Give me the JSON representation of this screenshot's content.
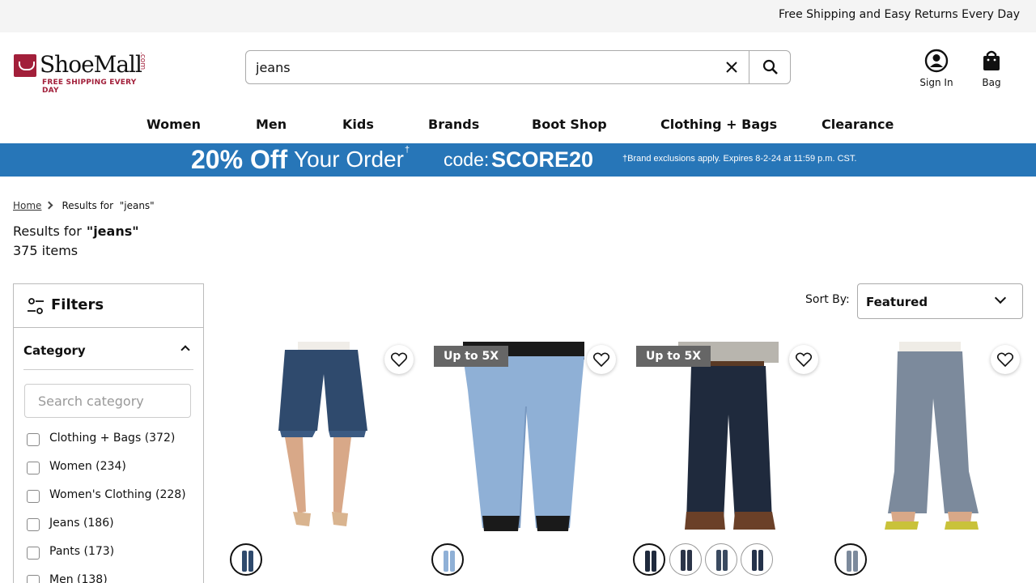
{
  "topbar": {
    "promo": "Free Shipping and Easy Returns Every Day"
  },
  "logo": {
    "name": "ShoeMall",
    "suffix": ".com",
    "tagline": "FREE SHIPPING EVERY DAY",
    "brand_color": "#a21f3a"
  },
  "search": {
    "value": "jeans",
    "clear_icon": "close-icon",
    "submit_icon": "search-icon"
  },
  "account": {
    "signin_label": "Sign In",
    "bag_label": "Bag"
  },
  "nav": {
    "items": [
      "Women",
      "Men",
      "Kids",
      "Brands",
      "Boot Shop",
      "Clothing + Bags",
      "Clearance"
    ]
  },
  "banner": {
    "big": "20% Off",
    "order": "Your Order",
    "dagger": "†",
    "code_label": "code:",
    "code": "SCORE20",
    "fine_print": "†Brand exclusions apply. Expires 8-2-24 at 11:59 p.m. CST.",
    "color": "#2776b8"
  },
  "breadcrumb": {
    "home": "Home",
    "current_label": "Results for",
    "current_query": "\"jeans\""
  },
  "results": {
    "label": "Results for",
    "query": "\"jeans\"",
    "count": "375 items"
  },
  "filters": {
    "title": "Filters",
    "category_heading": "Category",
    "search_placeholder": "Search category",
    "options": [
      {
        "label": "Clothing + Bags (372)"
      },
      {
        "label": "Women (234)"
      },
      {
        "label": "Women's Clothing (228)"
      },
      {
        "label": "Jeans (186)"
      },
      {
        "label": "Pants (173)"
      },
      {
        "label": "Men (138)"
      }
    ]
  },
  "sort": {
    "label": "Sort By:",
    "value": "Featured"
  },
  "products": [
    {
      "badge": "",
      "swatches": 1
    },
    {
      "badge": "Up to 5X",
      "swatches": 1
    },
    {
      "badge": "Up to 5X",
      "swatches": 4
    },
    {
      "badge": "",
      "swatches": 1
    }
  ]
}
